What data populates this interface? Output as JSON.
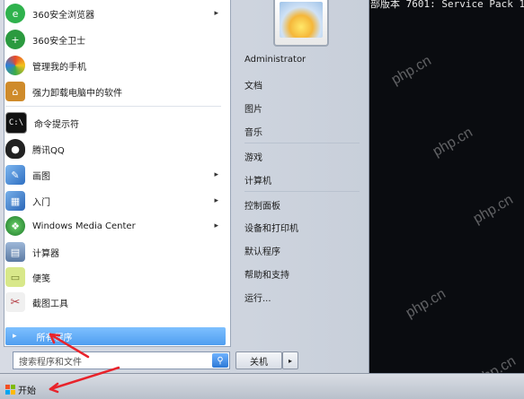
{
  "desktop": {
    "top_text": "部版本 7601: Service Pack 1)",
    "watermark": "php.cn"
  },
  "left_pane": {
    "apps": [
      {
        "label": "360安全浏览器",
        "icon": "browser-360-icon",
        "arrow": "▸",
        "color": "#2fb24d"
      },
      {
        "label": "360安全卫士",
        "icon": "shield-360-icon",
        "arrow": "",
        "color": "#2b9a3f"
      },
      {
        "label": "管理我的手机",
        "icon": "phone-manager-icon",
        "arrow": "",
        "color": "#e9b21a"
      },
      {
        "label": "强力卸载电脑中的软件",
        "icon": "uninstall-icon",
        "arrow": "",
        "color": "#cf8b2b"
      },
      {
        "label": "命令提示符",
        "icon": "cmd-icon",
        "arrow": "",
        "color": "#111111"
      },
      {
        "label": "腾讯QQ",
        "icon": "qq-icon",
        "arrow": "",
        "color": "#222222"
      },
      {
        "label": "画图",
        "icon": "paint-icon",
        "arrow": "▸",
        "color": "#4d8fd6"
      },
      {
        "label": "入门",
        "icon": "getting-started-icon",
        "arrow": "▸",
        "color": "#3d7fc9"
      },
      {
        "label": "Windows Media Center",
        "icon": "media-center-icon",
        "arrow": "▸",
        "color": "#3a9a3c"
      },
      {
        "label": "计算器",
        "icon": "calculator-icon",
        "arrow": "",
        "color": "#6e8fb7"
      },
      {
        "label": "便笺",
        "icon": "sticky-notes-icon",
        "arrow": "",
        "color": "#cde06a"
      },
      {
        "label": "截图工具",
        "icon": "snipping-tool-icon",
        "arrow": "",
        "color": "#b33c43"
      }
    ],
    "all_programs": "所有程序",
    "all_programs_arrow": "▸"
  },
  "search": {
    "placeholder": "搜索程序和文件",
    "icon_glyph": "⚲"
  },
  "right_pane": {
    "items": [
      "Administrator",
      "文档",
      "图片",
      "音乐",
      "游戏",
      "计算机",
      "控制面板",
      "设备和打印机",
      "默认程序",
      "帮助和支持",
      "运行..."
    ]
  },
  "shutdown": {
    "label": "关机",
    "arrow": "▸"
  },
  "taskbar": {
    "start_label": "开始"
  },
  "colors": {
    "annotation": "#e8232b",
    "highlight": "#58a6f3"
  }
}
